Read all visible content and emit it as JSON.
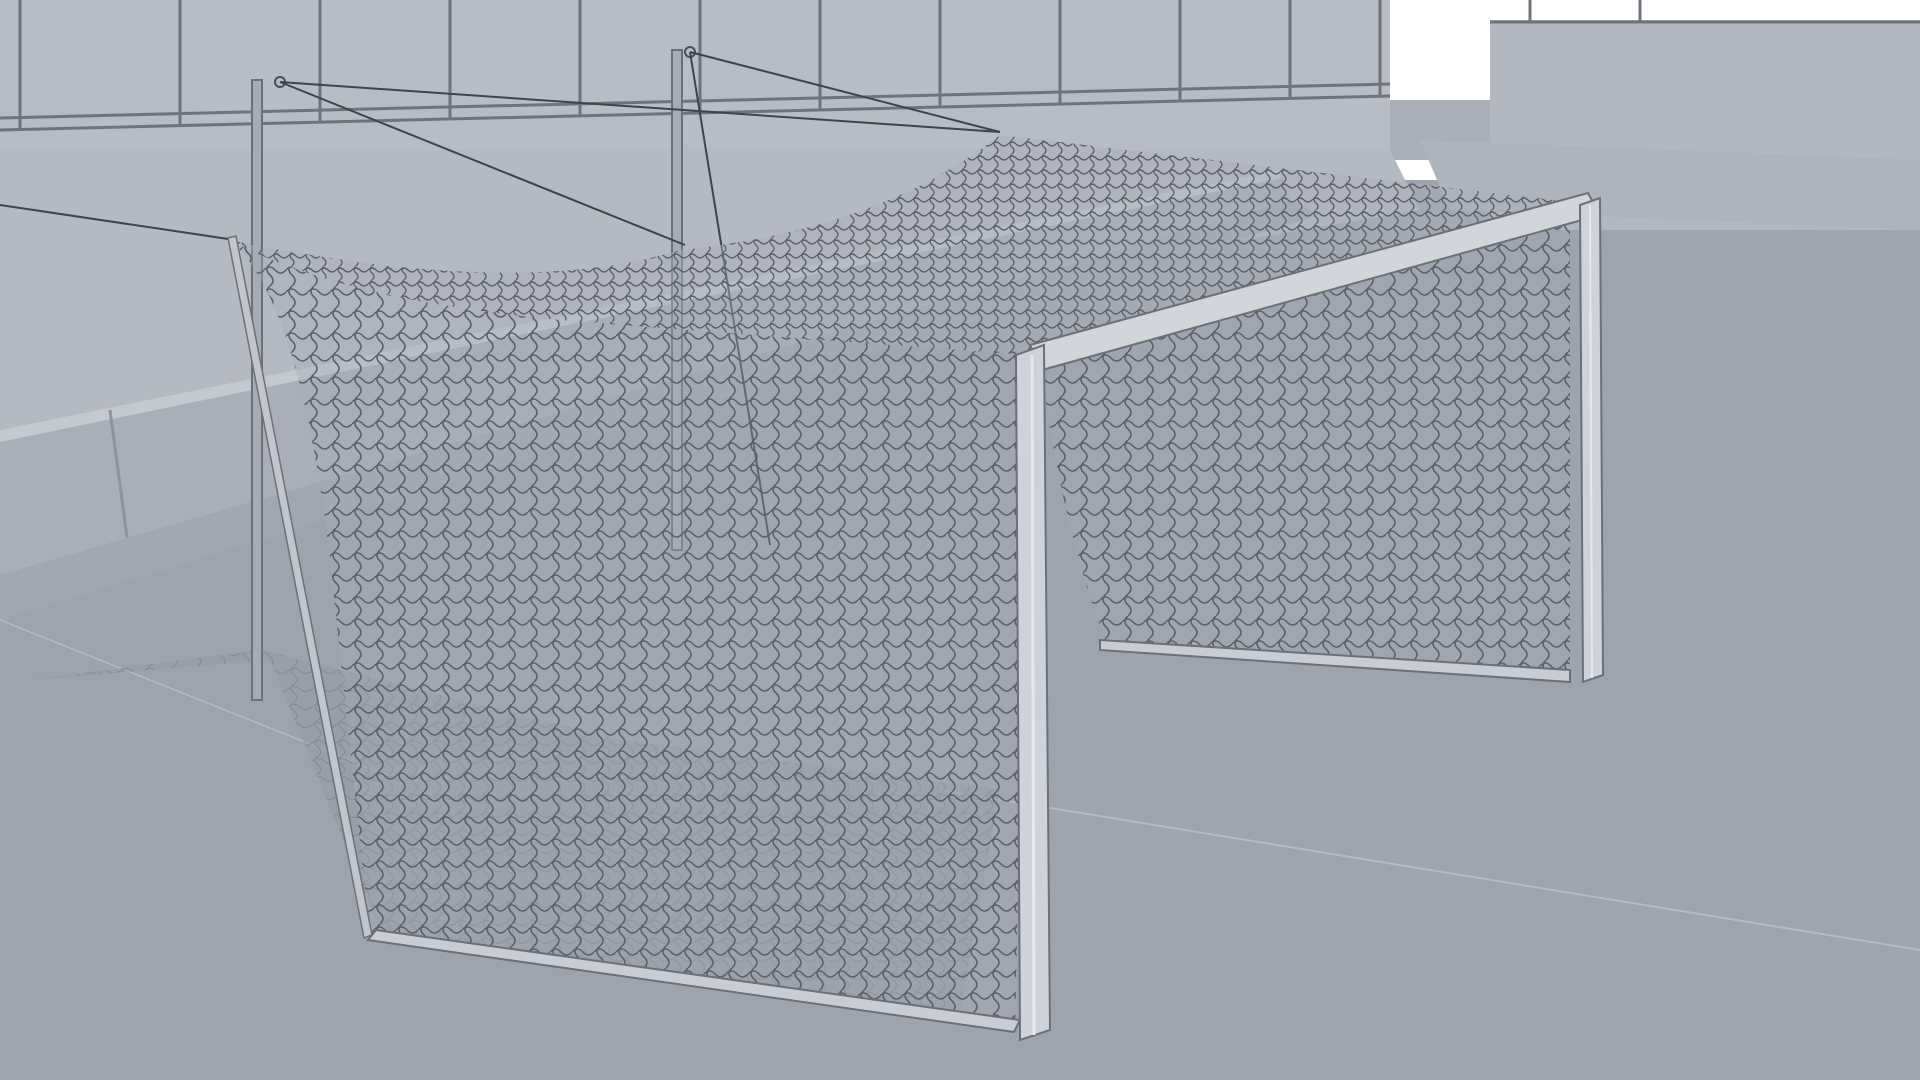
{
  "scene": {
    "subject": "soccer-goal-clay-render",
    "colors": {
      "sky": "#ffffff",
      "wall": "#b7bcc5",
      "wall_dark": "#a9aeb8",
      "ground": "#9ea4ae",
      "ground_far": "#a7adb6",
      "frame": "#c9cdd3",
      "frame_edge": "#6b7079",
      "net": "#5a5f68",
      "shadow": "#8a909a",
      "rail": "#6f747c"
    }
  }
}
